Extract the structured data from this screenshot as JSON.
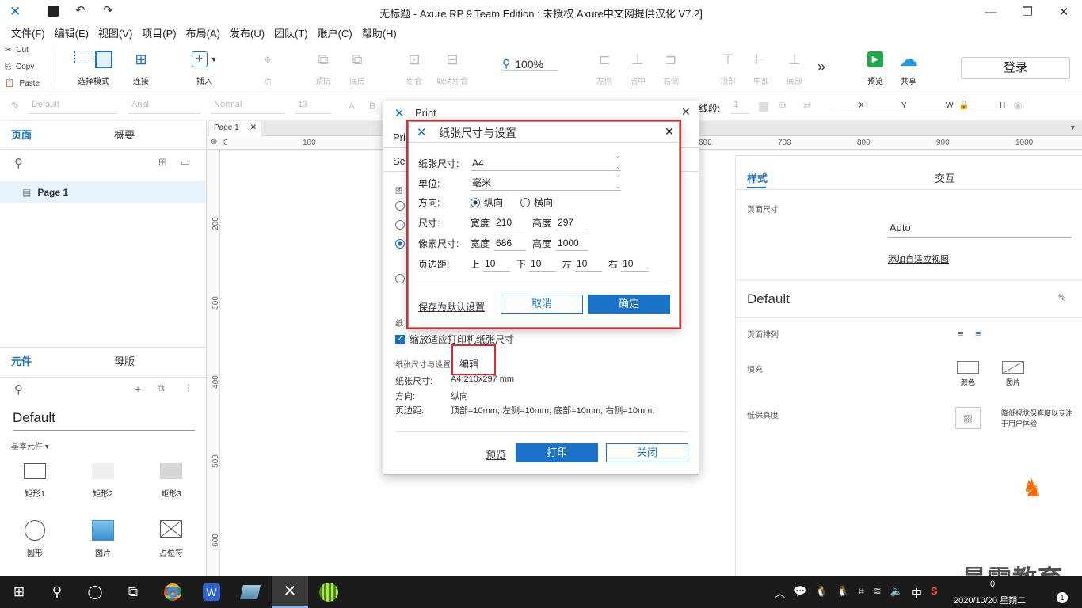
{
  "window": {
    "title": "无标题 - Axure RP 9 Team Edition : 未授权     Axure中文网提供汉化 V7.2]",
    "minimize": "—",
    "maximize": "❐",
    "close": "✕"
  },
  "menu": [
    "文件(F)",
    "编辑(E)",
    "视图(V)",
    "项目(P)",
    "布局(A)",
    "发布(U)",
    "团队(T)",
    "账户(C)",
    "帮助(H)"
  ],
  "clipboard": {
    "cut": "Cut",
    "copy": "Copy",
    "paste": "Paste"
  },
  "toolbar": {
    "select_mode": "选择模式",
    "connect": "连接",
    "insert": "插入",
    "point": "点",
    "top_layer": "顶层",
    "bottom_layer": "底层",
    "group": "组合",
    "ungroup": "取消组合",
    "zoom": "100%",
    "left": "左侧",
    "center": "居中",
    "right": "右侧",
    "top": "顶部",
    "middle": "中部",
    "bottom": "底部",
    "more": "»",
    "preview": "预览",
    "share": "共享",
    "login": "登录"
  },
  "stylebar": {
    "style": "Default",
    "font": "Arial",
    "weight": "Normal",
    "size": "13",
    "line_label": "线段:",
    "line_value": "1",
    "x": "X",
    "y": "Y",
    "w": "W",
    "h": "H"
  },
  "pages_panel": {
    "tab_pages": "页面",
    "tab_outline": "概要",
    "page_item": "Page 1"
  },
  "widgets_panel": {
    "tab_widgets": "元件",
    "tab_masters": "母版",
    "library": "Default",
    "category": "基本元件 ▾",
    "items": [
      "矩形1",
      "矩形2",
      "矩形3",
      "圆形",
      "图片",
      "占位符"
    ]
  },
  "canvas": {
    "tab": "Page 1",
    "ruler_h": [
      "0",
      "100",
      "600",
      "700",
      "800",
      "900",
      "1000"
    ],
    "ruler_v": [
      "200",
      "300",
      "400",
      "500",
      "600"
    ]
  },
  "right_panel": {
    "tab_style": "样式",
    "tab_interact": "交互",
    "page_size_label": "页面尺寸",
    "page_size_value": "Auto",
    "add_adaptive": "添加自适应视图",
    "style_name": "Default",
    "page_align": "页面排列",
    "fill": "填充",
    "fill_color": "颜色",
    "fill_image": "图片",
    "low_fidelity": "低保真度",
    "low_fidelity_desc": "降低视觉保真度以专注于用户体验"
  },
  "print_dialog": {
    "title": "Print",
    "tab_peek": "Pri",
    "sc_peek": "Sc",
    "graph_peek": "图",
    "paper_label_peek": "纸",
    "fit_checkbox": "缩放适应打印机纸张尺寸",
    "paper_settings_label": "纸张尺寸与设置",
    "edit": "编辑",
    "paper_size_label": "纸张尺寸:",
    "paper_size_value": "A4;210x297 mm",
    "orientation_label": "方向:",
    "orientation_value": "纵向",
    "margin_label": "页边距:",
    "margin_value": "顶部=10mm; 左侧=10mm; 底部=10mm; 右侧=10mm;",
    "preview": "预览",
    "print": "打印",
    "close": "关闭"
  },
  "paper_dialog": {
    "title": "纸张尺寸与设置",
    "paper_size_label": "纸张尺寸:",
    "paper_size_value": "A4",
    "unit_label": "单位:",
    "unit_value": "毫米",
    "orientation_label": "方向:",
    "portrait": "纵向",
    "landscape": "横向",
    "size_label": "尺寸:",
    "width_label": "宽度",
    "width_value": "210",
    "height_label": "高度",
    "height_value": "297",
    "pixel_label": "像素尺寸:",
    "pixel_width": "686",
    "pixel_height": "1000",
    "margin_label": "页边距:",
    "top_label": "上",
    "top_value": "10",
    "bottom_label": "下",
    "bottom_value": "10",
    "left_label": "左",
    "left_value": "10",
    "right_label": "右",
    "right_value": "10",
    "save_default": "保存为默认设置",
    "cancel": "取消",
    "ok": "确定"
  },
  "taskbar": {
    "ime": "中",
    "time": "0",
    "date": "2020/10/20 星期二",
    "notify": "1"
  },
  "watermark": "最需教育",
  "colors": {
    "accent": "#1a73c8",
    "highlight": "#e0272b",
    "taskbar": "#1b1b1b"
  }
}
